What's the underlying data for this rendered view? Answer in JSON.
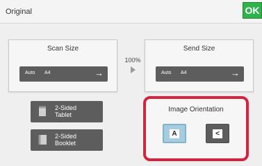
{
  "header": {
    "title": "Original",
    "ok_label": "OK"
  },
  "scan_size": {
    "label": "Scan Size",
    "mode": "Auto",
    "value": "A4"
  },
  "send_size": {
    "label": "Send Size",
    "mode": "Auto",
    "value": "A4"
  },
  "ratio": "100%",
  "duplex": {
    "tablet_label": "2-Sided Tablet",
    "tablet_lines": [
      "2-Sided",
      "Tablet"
    ],
    "booklet_lines": [
      "2-Sided",
      "Booklet"
    ]
  },
  "orientation": {
    "title": "Image Orientation",
    "portrait_glyph": "A",
    "landscape_glyph": "<"
  },
  "colors": {
    "ok": "#2fb24a",
    "highlight": "#d8213a",
    "selected": "#a6ccdf",
    "button": "#5d5d5d"
  },
  "icons": [
    "right-arrow-icon",
    "play-arrow-icon",
    "tablet-doc-icon",
    "booklet-doc-icon"
  ]
}
